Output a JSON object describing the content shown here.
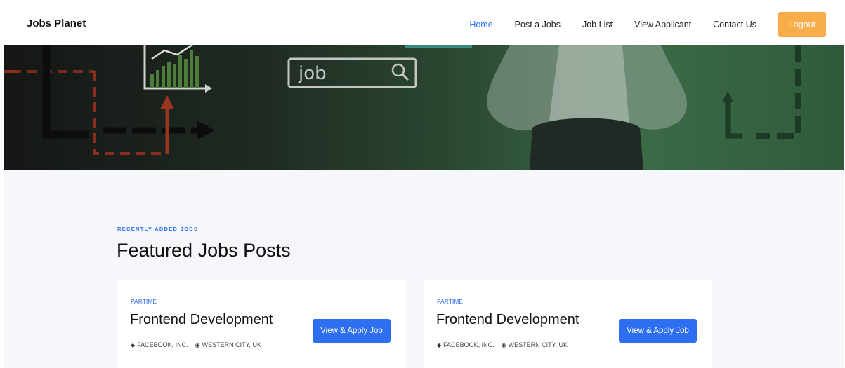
{
  "header": {
    "brand": "Jobs Planet",
    "nav": [
      {
        "label": "Home",
        "active": true
      },
      {
        "label": "Post a Jobs",
        "active": false
      },
      {
        "label": "Job List",
        "active": false
      },
      {
        "label": "View Applicant",
        "active": false
      },
      {
        "label": "Contact Us",
        "active": false
      }
    ],
    "logout_label": "Logout"
  },
  "hero": {
    "search_word": "job"
  },
  "section": {
    "subtitle": "RECENTLY ADDED JOBS",
    "title": "Featured Jobs Posts"
  },
  "jobs": [
    {
      "type": "PARTIME",
      "title": "Frontend Development",
      "company": "FACEBOOK, INC.",
      "location": "WESTERN CITY, UK",
      "button": "View & Apply Job"
    },
    {
      "type": "PARTIME",
      "title": "Frontend Development",
      "company": "FACEBOOK, INC.",
      "location": "WESTERN CITY, UK",
      "button": "View & Apply Job"
    }
  ],
  "colors": {
    "accent": "#2e6ff2",
    "logout": "#f9ad4a",
    "page_bg": "#f6f7fb"
  }
}
